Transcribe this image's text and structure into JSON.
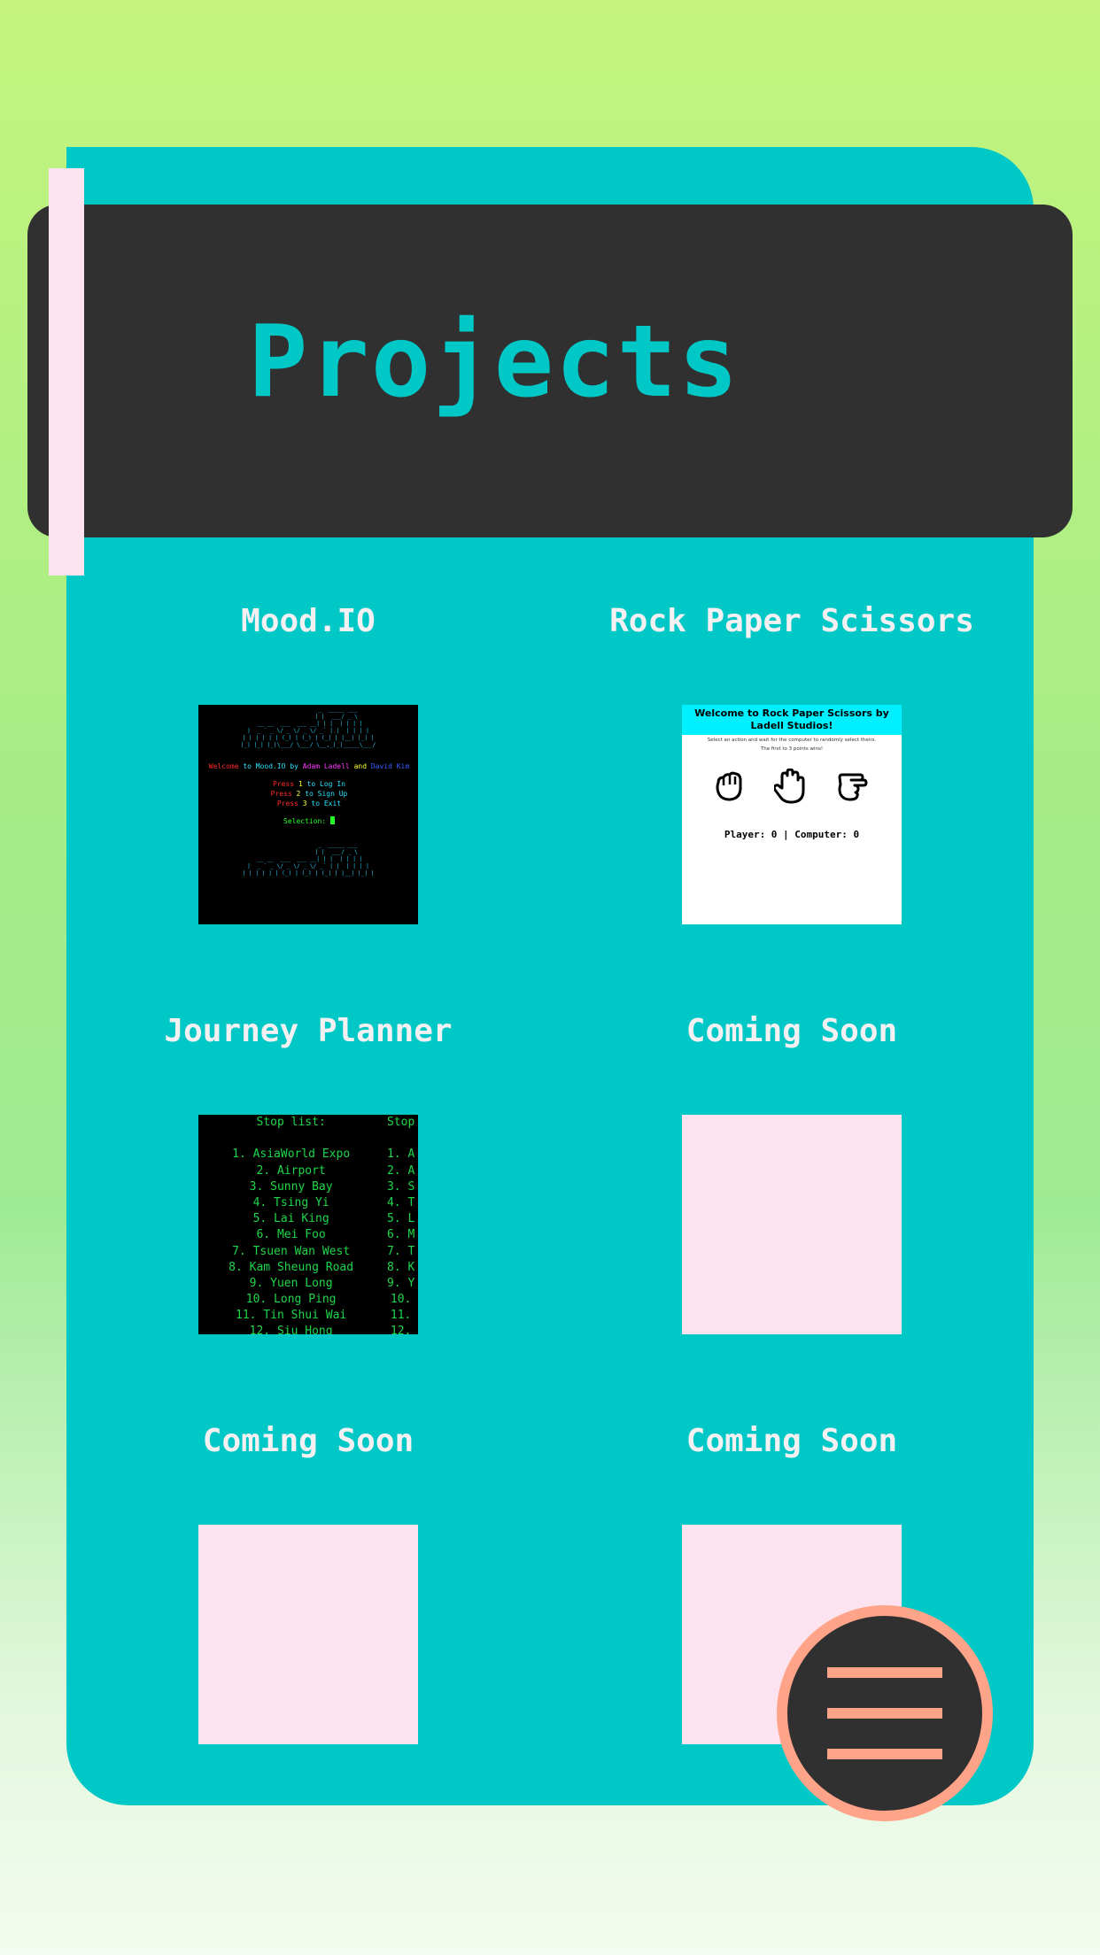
{
  "header": {
    "title": "Projects"
  },
  "projects": [
    {
      "title": "Mood.IO",
      "thumbnail": "terminal-mood"
    },
    {
      "title": "Rock Paper Scissors",
      "thumbnail": "rps-game"
    },
    {
      "title": "Journey Planner",
      "thumbnail": "terminal-journey"
    },
    {
      "title": "Coming Soon",
      "thumbnail": "placeholder"
    },
    {
      "title": "Coming Soon",
      "thumbnail": "placeholder"
    },
    {
      "title": "Coming Soon",
      "thumbnail": "placeholder"
    }
  ],
  "mood": {
    "ascii_top": "                  _  _____ ___\n                 | |  ___/ _ \\\n __ __  ___  ___ __| | |  | | | |\n|  _ ` _ \\/ _ \\/ _ \\/ _` | |  | | | |\n| | | | | | (_) | (_) | (_| | |__| |_| |\n|_| |_| |_|\\___/ \\___/ \\__,_|_|_____\\___/",
    "ascii_bottom": "                  _  _____ ___\n                 | |  ___/ _ \\\n __ __  ___  ___ __| | |  | | | |\n|  _ ` _ \\/ _ \\/ _ \\/ _` | |  | | | |\n| | | | | | (_) | (_) | (_| | |__| |_| |",
    "welcome": "Welcome",
    "to": " to ",
    "app": "Mood.IO",
    "by": " by ",
    "author1": "Adam Ladell",
    "and": " and ",
    "author2": "David Kim",
    "press": "Press ",
    "options": [
      {
        "key": "1",
        "text": " to Log In"
      },
      {
        "key": "2",
        "text": " to Sign Up"
      },
      {
        "key": "3",
        "text": " to Exit"
      }
    ],
    "selection": "Selection: "
  },
  "rps": {
    "banner": "Welcome to Rock Paper Scissors by Ladell Studios!",
    "instructions": "Select an action and wait for the computer to randomly select theirs.",
    "first_to": "The first to 3 points wins!",
    "score": "Player: 0 | Computer: 0"
  },
  "journey": {
    "header_left": "Stop list:",
    "header_right": "Stop",
    "stops": [
      "1. AsiaWorld Expo",
      "2. Airport",
      "3. Sunny Bay",
      "4. Tsing Yi",
      "5. Lai King",
      "6. Mei Foo",
      "7. Tsuen Wan West",
      "8. Kam Sheung Road",
      "9. Yuen Long",
      "10. Long Ping",
      "11. Tin Shui Wai",
      "12. Siu Hong"
    ],
    "right_col": [
      "1. A",
      "2. A",
      "3. S",
      "4. T",
      "5. L",
      "6. M",
      "7. T",
      "8. K",
      "9. Y",
      "10.",
      "11.",
      "12."
    ]
  },
  "colors": {
    "background_top": "#c4f47e",
    "card": "#00c8c6",
    "panel": "#303030",
    "accent_pink": "#fde2ef",
    "menu_accent": "#ffa489"
  },
  "menu": {
    "icon": "hamburger-icon"
  }
}
